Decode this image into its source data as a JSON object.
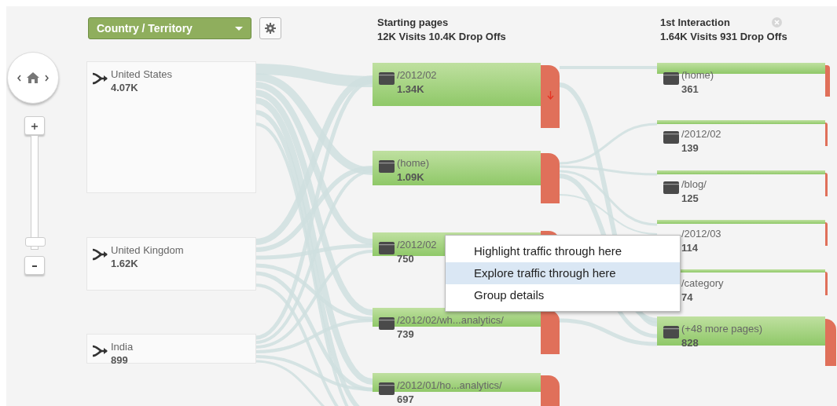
{
  "dimension_selector": {
    "label": "Country / Territory"
  },
  "zoom": {
    "level": 0.04
  },
  "source_nodes": [
    {
      "label": "United States",
      "count": "4.07K"
    },
    {
      "label": "United Kingdom",
      "count": "1.62K"
    },
    {
      "label": "India",
      "count": "899"
    }
  ],
  "columns": [
    {
      "title": "Starting pages",
      "summary": "12K Visits 10.4K Drop Offs",
      "closable": false,
      "nodes": [
        {
          "label": "/2012/02",
          "count": "1.34K",
          "icon": true,
          "drop_arrow": true
        },
        {
          "label": "(home)",
          "count": "1.09K",
          "icon": true,
          "drop_arrow": false
        },
        {
          "label": "/2012/02",
          "count": "750",
          "icon": true,
          "drop_arrow": false
        },
        {
          "label": "/2012/02/wh...analytics/",
          "count": "739",
          "icon": true,
          "drop_arrow": false
        },
        {
          "label": "/2012/01/ho...analytics/",
          "count": "697",
          "icon": true,
          "drop_arrow": false
        }
      ]
    },
    {
      "title": "1st Interaction",
      "summary": "1.64K Visits 931 Drop Offs",
      "closable": true,
      "nodes": [
        {
          "label": "(home)",
          "count": "361",
          "icon": true,
          "drop_arrow": false
        },
        {
          "label": "/2012/02",
          "count": "139",
          "icon": true,
          "drop_arrow": false
        },
        {
          "label": "/blog/",
          "count": "125",
          "icon": true,
          "drop_arrow": false
        },
        {
          "label": "/2012/03",
          "count": "114",
          "icon": false,
          "drop_arrow": false
        },
        {
          "label": "/category",
          "count": "74",
          "icon": false,
          "drop_arrow": false
        },
        {
          "label": "(+48 more pages)",
          "count": "828",
          "icon": true,
          "drop_arrow": false
        }
      ]
    }
  ],
  "context_menu": {
    "items": [
      {
        "label": "Highlight traffic through here",
        "selected": false
      },
      {
        "label": "Explore traffic through here",
        "selected": true
      },
      {
        "label": "Group details",
        "selected": false
      }
    ]
  }
}
